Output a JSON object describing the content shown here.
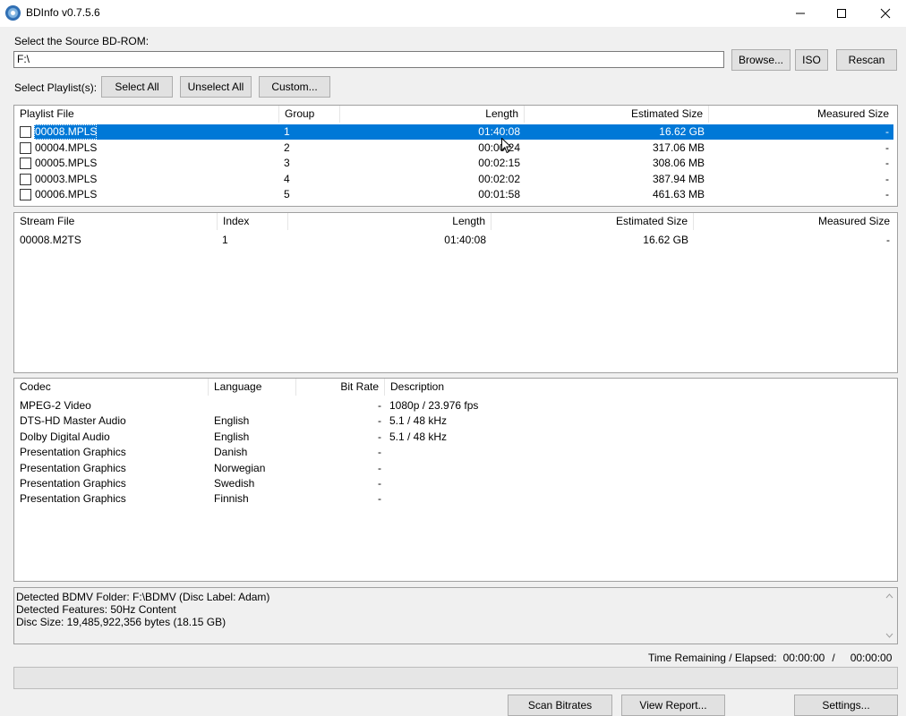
{
  "window": {
    "title": "BDInfo v0.7.5.6"
  },
  "source": {
    "label": "Select the Source BD-ROM:",
    "path": "F:\\",
    "browse": "Browse...",
    "iso": "ISO",
    "rescan": "Rescan"
  },
  "playlists_bar": {
    "label": "Select Playlist(s):",
    "select_all": "Select All",
    "unselect_all": "Unselect All",
    "custom": "Custom..."
  },
  "playlists": {
    "headers": [
      "Playlist File",
      "Group",
      "Length",
      "Estimated Size",
      "Measured Size"
    ],
    "rows": [
      {
        "file": "00008.MPLS",
        "group": "1",
        "length": "01:40:08",
        "est": "16.62 GB",
        "meas": "-",
        "selected": true
      },
      {
        "file": "00004.MPLS",
        "group": "2",
        "length": "00:00:24",
        "est": "317.06 MB",
        "meas": "-",
        "selected": false
      },
      {
        "file": "00005.MPLS",
        "group": "3",
        "length": "00:02:15",
        "est": "308.06 MB",
        "meas": "-",
        "selected": false
      },
      {
        "file": "00003.MPLS",
        "group": "4",
        "length": "00:02:02",
        "est": "387.94 MB",
        "meas": "-",
        "selected": false
      },
      {
        "file": "00006.MPLS",
        "group": "5",
        "length": "00:01:58",
        "est": "461.63 MB",
        "meas": "-",
        "selected": false
      }
    ]
  },
  "streams": {
    "headers": [
      "Stream File",
      "Index",
      "Length",
      "Estimated Size",
      "Measured Size"
    ],
    "rows": [
      {
        "file": "00008.M2TS",
        "index": "1",
        "length": "01:40:08",
        "est": "16.62 GB",
        "meas": "-"
      }
    ]
  },
  "codecs": {
    "headers": [
      "Codec",
      "Language",
      "Bit Rate",
      "Description"
    ],
    "rows": [
      {
        "codec": "MPEG-2 Video",
        "lang": "",
        "bitrate": "-",
        "desc": "1080p / 23.976 fps"
      },
      {
        "codec": "DTS-HD Master Audio",
        "lang": "English",
        "bitrate": "-",
        "desc": "5.1 / 48 kHz"
      },
      {
        "codec": "Dolby Digital Audio",
        "lang": "English",
        "bitrate": "-",
        "desc": "5.1 / 48 kHz"
      },
      {
        "codec": "Presentation Graphics",
        "lang": "Danish",
        "bitrate": "-",
        "desc": ""
      },
      {
        "codec": "Presentation Graphics",
        "lang": "Norwegian",
        "bitrate": "-",
        "desc": ""
      },
      {
        "codec": "Presentation Graphics",
        "lang": "Swedish",
        "bitrate": "-",
        "desc": ""
      },
      {
        "codec": "Presentation Graphics",
        "lang": "Finnish",
        "bitrate": "-",
        "desc": ""
      }
    ]
  },
  "log": {
    "lines": [
      "Detected BDMV Folder: F:\\BDMV (Disc Label: Adam)",
      "Detected Features: 50Hz Content",
      "Disc Size: 19,485,922,356 bytes (18.15 GB)"
    ]
  },
  "status": {
    "label": "Time Remaining / Elapsed:",
    "remaining": "00:00:00",
    "separator": "/",
    "elapsed": "00:00:00"
  },
  "footer": {
    "scan": "Scan Bitrates",
    "report": "View Report...",
    "settings": "Settings..."
  },
  "progress": {
    "fraction": 0
  }
}
